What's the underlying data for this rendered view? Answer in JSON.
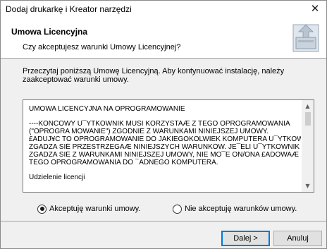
{
  "window": {
    "title": "Dodaj drukarkę i Kreator narzędzi",
    "close_glyph": "✕"
  },
  "header": {
    "title": "Umowa Licencyjna",
    "subtitle": "Czy akceptujesz warunki Umowy Licencyjnej?",
    "icon": "wizard-install-icon"
  },
  "instructions": "Przeczytaj poniższą Umowę Licencyjną. Aby kontynuować instalację, należy zaakceptować warunki umowy.",
  "license": {
    "paragraphs": [
      "UMOWA LICENCYJNA NA OPROGRAMOWANIE",
      "----KOŃCOWY U¯YTKOWNIK MUSI KORZYSTAÆ Z TEGO OPROGRAMOWANIA",
      "(\"OPROGRA MOWANIE\") ZGODNIE Z WARUNKAMI NINIEJSZEJ UMOWY.",
      "£ADUJ¥C TO OPROGRAMOWANIE DO JAKIEGOKOLWIEK KOMPUTERA U¯YTKOWNIK",
      "ZGADZA SIÊ PRZESTRZEGAÆ NINIEJSZYCH WARUNKÓW. JE¯ELI U¯YTKOWNIK NIE",
      "ZGADZA SIÊ Z WARUNKAMI NINIEJSZEJ UMOWY, NIE MO¯E ON/ONA £ADOWAÆ",
      "TEGO OPROGRAMOWANIA DO ¯ADNEGO KOMPUTERA.",
      "Udzielenie licencji"
    ],
    "scroll_up_glyph": "▲",
    "scroll_down_glyph": "▼"
  },
  "options": {
    "accept_label": "Akceptuję warunki umowy.",
    "decline_label": "Nie akceptuję warunków umowy.",
    "selected": "accept"
  },
  "buttons": {
    "next_label": "Dalej >",
    "cancel_label": "Anuluj"
  }
}
